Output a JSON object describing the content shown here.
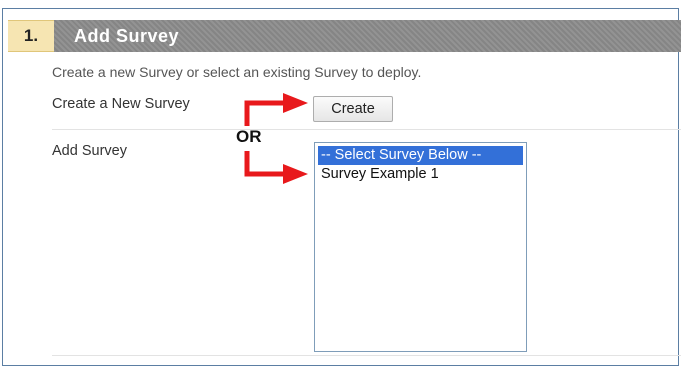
{
  "section": {
    "step_number": "1.",
    "title": "Add Survey",
    "instructions": "Create a new Survey or select an existing Survey to deploy."
  },
  "create_row": {
    "label": "Create a New Survey",
    "button_label": "Create"
  },
  "or_label": "OR",
  "add_row": {
    "label": "Add Survey",
    "options": [
      {
        "text": "-- Select Survey Below --",
        "selected": true
      },
      {
        "text": "Survey Example 1",
        "selected": false
      }
    ]
  },
  "colors": {
    "arrow": "#e8191c",
    "selection": "#3370d8",
    "header_bg": "#8c8c8c",
    "step_bg": "#f6e5b2"
  }
}
